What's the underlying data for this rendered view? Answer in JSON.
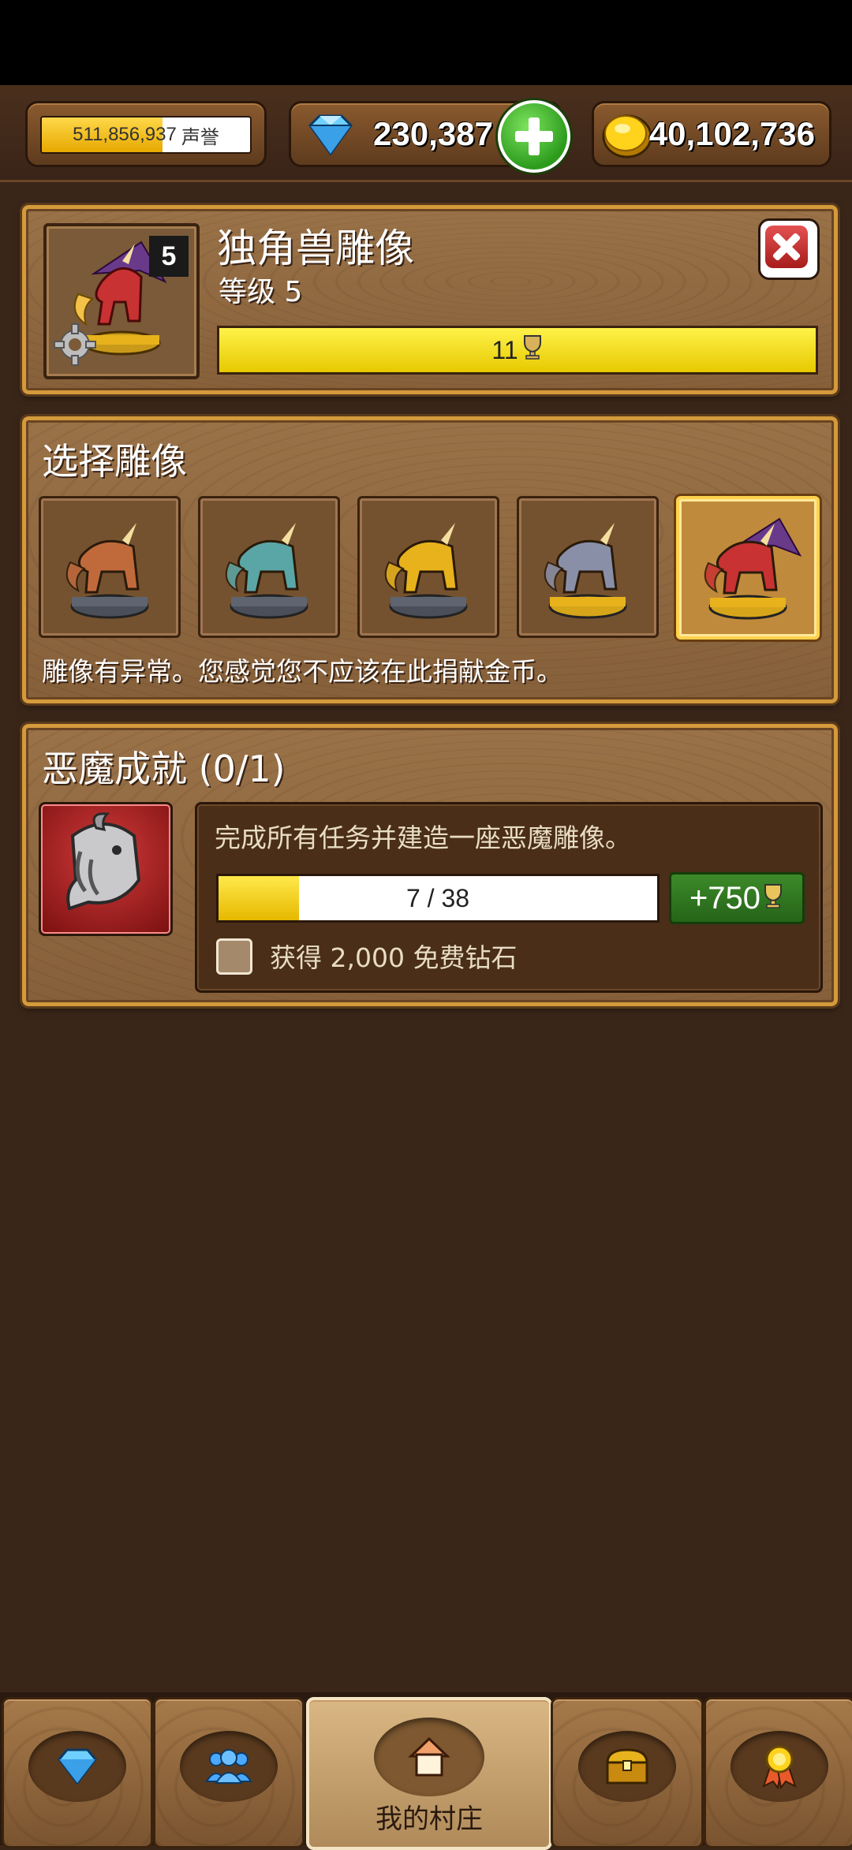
{
  "topbar": {
    "reputation_value": "511,856,937",
    "reputation_label": "声誉",
    "reputation_progress": 0.58,
    "gems": "230,387",
    "gold": "40,102,736"
  },
  "statue": {
    "name": "独角兽雕像",
    "level_text": "等级 5",
    "level_badge": "5",
    "trophies": "11"
  },
  "select": {
    "title": "选择雕像",
    "items": [
      {
        "name": "bronze-unicorn",
        "color": "#c06a3c"
      },
      {
        "name": "teal-unicorn",
        "color": "#5aa6a6"
      },
      {
        "name": "gold-unicorn",
        "color": "#e8b21c"
      },
      {
        "name": "silver-unicorn",
        "color": "#8a8fa8"
      },
      {
        "name": "demon-unicorn",
        "color": "#c83232"
      }
    ],
    "selected_index": 4,
    "description": "雕像有异常。您感觉您不应该在此捐献金币。"
  },
  "achievement": {
    "title": "恶魔成就 (0/1)",
    "description": "完成所有任务并建造一座恶魔雕像。",
    "progress_text": "7 / 38",
    "progress_fraction": 0.184,
    "reward": "+750",
    "checkbox_label": "获得 2,000 免费钻石"
  },
  "nav": {
    "tabs": [
      {
        "icon": "diamond-icon"
      },
      {
        "icon": "people-icon"
      },
      {
        "icon": "home-icon",
        "label": "我的村庄"
      },
      {
        "icon": "treasure-chest-icon"
      },
      {
        "icon": "medal-icon"
      }
    ]
  }
}
